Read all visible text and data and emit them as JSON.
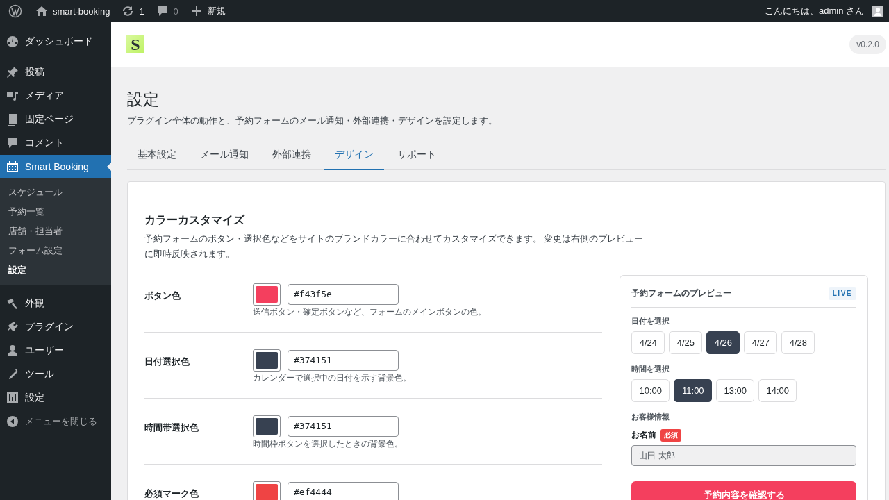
{
  "admin_bar": {
    "site": "smart-booking",
    "updates": "1",
    "comments": "0",
    "new": "新規",
    "greeting": "こんにちは、admin さん"
  },
  "sidebar": {
    "items": [
      {
        "label": "ダッシュボード",
        "selected": false
      },
      {
        "label": "投稿",
        "selected": false
      },
      {
        "label": "メディア",
        "selected": false
      },
      {
        "label": "固定ページ",
        "selected": false
      },
      {
        "label": "コメント",
        "selected": false
      },
      {
        "label": "Smart Booking",
        "selected": true,
        "children": [
          {
            "label": "スケジュール",
            "selected": false
          },
          {
            "label": "予約一覧",
            "selected": false
          },
          {
            "label": "店舗・担当者",
            "selected": false
          },
          {
            "label": "フォーム設定",
            "selected": false
          },
          {
            "label": "設定",
            "selected": true
          }
        ]
      },
      {
        "label": "外観",
        "selected": false
      },
      {
        "label": "プラグイン",
        "selected": false
      },
      {
        "label": "ユーザー",
        "selected": false
      },
      {
        "label": "ツール",
        "selected": false
      },
      {
        "label": "設定",
        "selected": false
      }
    ],
    "collapse": "メニューを閉じる"
  },
  "header": {
    "logo": "S",
    "version": "v0.2.0"
  },
  "page": {
    "title": "設定",
    "description": "プラグイン全体の動作と、予約フォームのメール通知・外部連携・デザインを設定します。"
  },
  "tabs": [
    {
      "label": "基本設定",
      "selected": false
    },
    {
      "label": "メール通知",
      "selected": false
    },
    {
      "label": "外部連携",
      "selected": false
    },
    {
      "label": "デザイン",
      "selected": true
    },
    {
      "label": "サポート",
      "selected": false
    }
  ],
  "section": {
    "title": "カラーカスタマイズ",
    "description": "予約フォームのボタン・選択色などをサイトのブランドカラーに合わせてカスタマイズできます。 変更は右側のプレビューに即時反映されます。"
  },
  "color_settings": [
    {
      "label": "ボタン色",
      "value": "#f43f5e",
      "hint": "送信ボタン・確定ボタンなど、フォームのメインボタンの色。"
    },
    {
      "label": "日付選択色",
      "value": "#374151",
      "hint": "カレンダーで選択中の日付を示す背景色。"
    },
    {
      "label": "時間帯選択色",
      "value": "#374151",
      "hint": "時間枠ボタンを選択したときの背景色。"
    },
    {
      "label": "必須マーク色",
      "value": "#ef4444"
    }
  ],
  "preview": {
    "title": "予約フォームのプレビュー",
    "badge": "LIVE",
    "date_label": "日付を選択",
    "dates": [
      {
        "label": "4/24",
        "selected": false
      },
      {
        "label": "4/25",
        "selected": false
      },
      {
        "label": "4/26",
        "selected": true
      },
      {
        "label": "4/27",
        "selected": false
      },
      {
        "label": "4/28",
        "selected": false
      }
    ],
    "time_label": "時間を選択",
    "times": [
      {
        "label": "10:00",
        "selected": false
      },
      {
        "label": "11:00",
        "selected": true
      },
      {
        "label": "13:00",
        "selected": false
      },
      {
        "label": "14:00",
        "selected": false
      }
    ],
    "customer_label": "お客様情報",
    "name_label": "お名前",
    "required": "必須",
    "name_placeholder": "山田 太郎",
    "submit": "予約内容を確認する"
  }
}
